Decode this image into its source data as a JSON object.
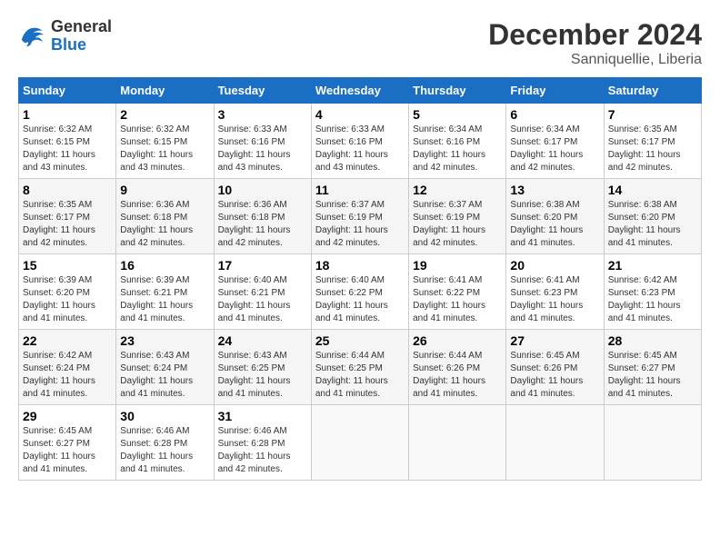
{
  "header": {
    "logo": {
      "general": "General",
      "blue": "Blue"
    },
    "title": "December 2024",
    "subtitle": "Sanniquellie, Liberia"
  },
  "weekdays": [
    "Sunday",
    "Monday",
    "Tuesday",
    "Wednesday",
    "Thursday",
    "Friday",
    "Saturday"
  ],
  "weeks": [
    [
      {
        "day": "1",
        "info": "Sunrise: 6:32 AM\nSunset: 6:15 PM\nDaylight: 11 hours\nand 43 minutes."
      },
      {
        "day": "2",
        "info": "Sunrise: 6:32 AM\nSunset: 6:15 PM\nDaylight: 11 hours\nand 43 minutes."
      },
      {
        "day": "3",
        "info": "Sunrise: 6:33 AM\nSunset: 6:16 PM\nDaylight: 11 hours\nand 43 minutes."
      },
      {
        "day": "4",
        "info": "Sunrise: 6:33 AM\nSunset: 6:16 PM\nDaylight: 11 hours\nand 43 minutes."
      },
      {
        "day": "5",
        "info": "Sunrise: 6:34 AM\nSunset: 6:16 PM\nDaylight: 11 hours\nand 42 minutes."
      },
      {
        "day": "6",
        "info": "Sunrise: 6:34 AM\nSunset: 6:17 PM\nDaylight: 11 hours\nand 42 minutes."
      },
      {
        "day": "7",
        "info": "Sunrise: 6:35 AM\nSunset: 6:17 PM\nDaylight: 11 hours\nand 42 minutes."
      }
    ],
    [
      {
        "day": "8",
        "info": "Sunrise: 6:35 AM\nSunset: 6:17 PM\nDaylight: 11 hours\nand 42 minutes."
      },
      {
        "day": "9",
        "info": "Sunrise: 6:36 AM\nSunset: 6:18 PM\nDaylight: 11 hours\nand 42 minutes."
      },
      {
        "day": "10",
        "info": "Sunrise: 6:36 AM\nSunset: 6:18 PM\nDaylight: 11 hours\nand 42 minutes."
      },
      {
        "day": "11",
        "info": "Sunrise: 6:37 AM\nSunset: 6:19 PM\nDaylight: 11 hours\nand 42 minutes."
      },
      {
        "day": "12",
        "info": "Sunrise: 6:37 AM\nSunset: 6:19 PM\nDaylight: 11 hours\nand 42 minutes."
      },
      {
        "day": "13",
        "info": "Sunrise: 6:38 AM\nSunset: 6:20 PM\nDaylight: 11 hours\nand 41 minutes."
      },
      {
        "day": "14",
        "info": "Sunrise: 6:38 AM\nSunset: 6:20 PM\nDaylight: 11 hours\nand 41 minutes."
      }
    ],
    [
      {
        "day": "15",
        "info": "Sunrise: 6:39 AM\nSunset: 6:20 PM\nDaylight: 11 hours\nand 41 minutes."
      },
      {
        "day": "16",
        "info": "Sunrise: 6:39 AM\nSunset: 6:21 PM\nDaylight: 11 hours\nand 41 minutes."
      },
      {
        "day": "17",
        "info": "Sunrise: 6:40 AM\nSunset: 6:21 PM\nDaylight: 11 hours\nand 41 minutes."
      },
      {
        "day": "18",
        "info": "Sunrise: 6:40 AM\nSunset: 6:22 PM\nDaylight: 11 hours\nand 41 minutes."
      },
      {
        "day": "19",
        "info": "Sunrise: 6:41 AM\nSunset: 6:22 PM\nDaylight: 11 hours\nand 41 minutes."
      },
      {
        "day": "20",
        "info": "Sunrise: 6:41 AM\nSunset: 6:23 PM\nDaylight: 11 hours\nand 41 minutes."
      },
      {
        "day": "21",
        "info": "Sunrise: 6:42 AM\nSunset: 6:23 PM\nDaylight: 11 hours\nand 41 minutes."
      }
    ],
    [
      {
        "day": "22",
        "info": "Sunrise: 6:42 AM\nSunset: 6:24 PM\nDaylight: 11 hours\nand 41 minutes."
      },
      {
        "day": "23",
        "info": "Sunrise: 6:43 AM\nSunset: 6:24 PM\nDaylight: 11 hours\nand 41 minutes."
      },
      {
        "day": "24",
        "info": "Sunrise: 6:43 AM\nSunset: 6:25 PM\nDaylight: 11 hours\nand 41 minutes."
      },
      {
        "day": "25",
        "info": "Sunrise: 6:44 AM\nSunset: 6:25 PM\nDaylight: 11 hours\nand 41 minutes."
      },
      {
        "day": "26",
        "info": "Sunrise: 6:44 AM\nSunset: 6:26 PM\nDaylight: 11 hours\nand 41 minutes."
      },
      {
        "day": "27",
        "info": "Sunrise: 6:45 AM\nSunset: 6:26 PM\nDaylight: 11 hours\nand 41 minutes."
      },
      {
        "day": "28",
        "info": "Sunrise: 6:45 AM\nSunset: 6:27 PM\nDaylight: 11 hours\nand 41 minutes."
      }
    ],
    [
      {
        "day": "29",
        "info": "Sunrise: 6:45 AM\nSunset: 6:27 PM\nDaylight: 11 hours\nand 41 minutes."
      },
      {
        "day": "30",
        "info": "Sunrise: 6:46 AM\nSunset: 6:28 PM\nDaylight: 11 hours\nand 41 minutes."
      },
      {
        "day": "31",
        "info": "Sunrise: 6:46 AM\nSunset: 6:28 PM\nDaylight: 11 hours\nand 42 minutes."
      },
      {
        "day": "",
        "info": ""
      },
      {
        "day": "",
        "info": ""
      },
      {
        "day": "",
        "info": ""
      },
      {
        "day": "",
        "info": ""
      }
    ]
  ]
}
